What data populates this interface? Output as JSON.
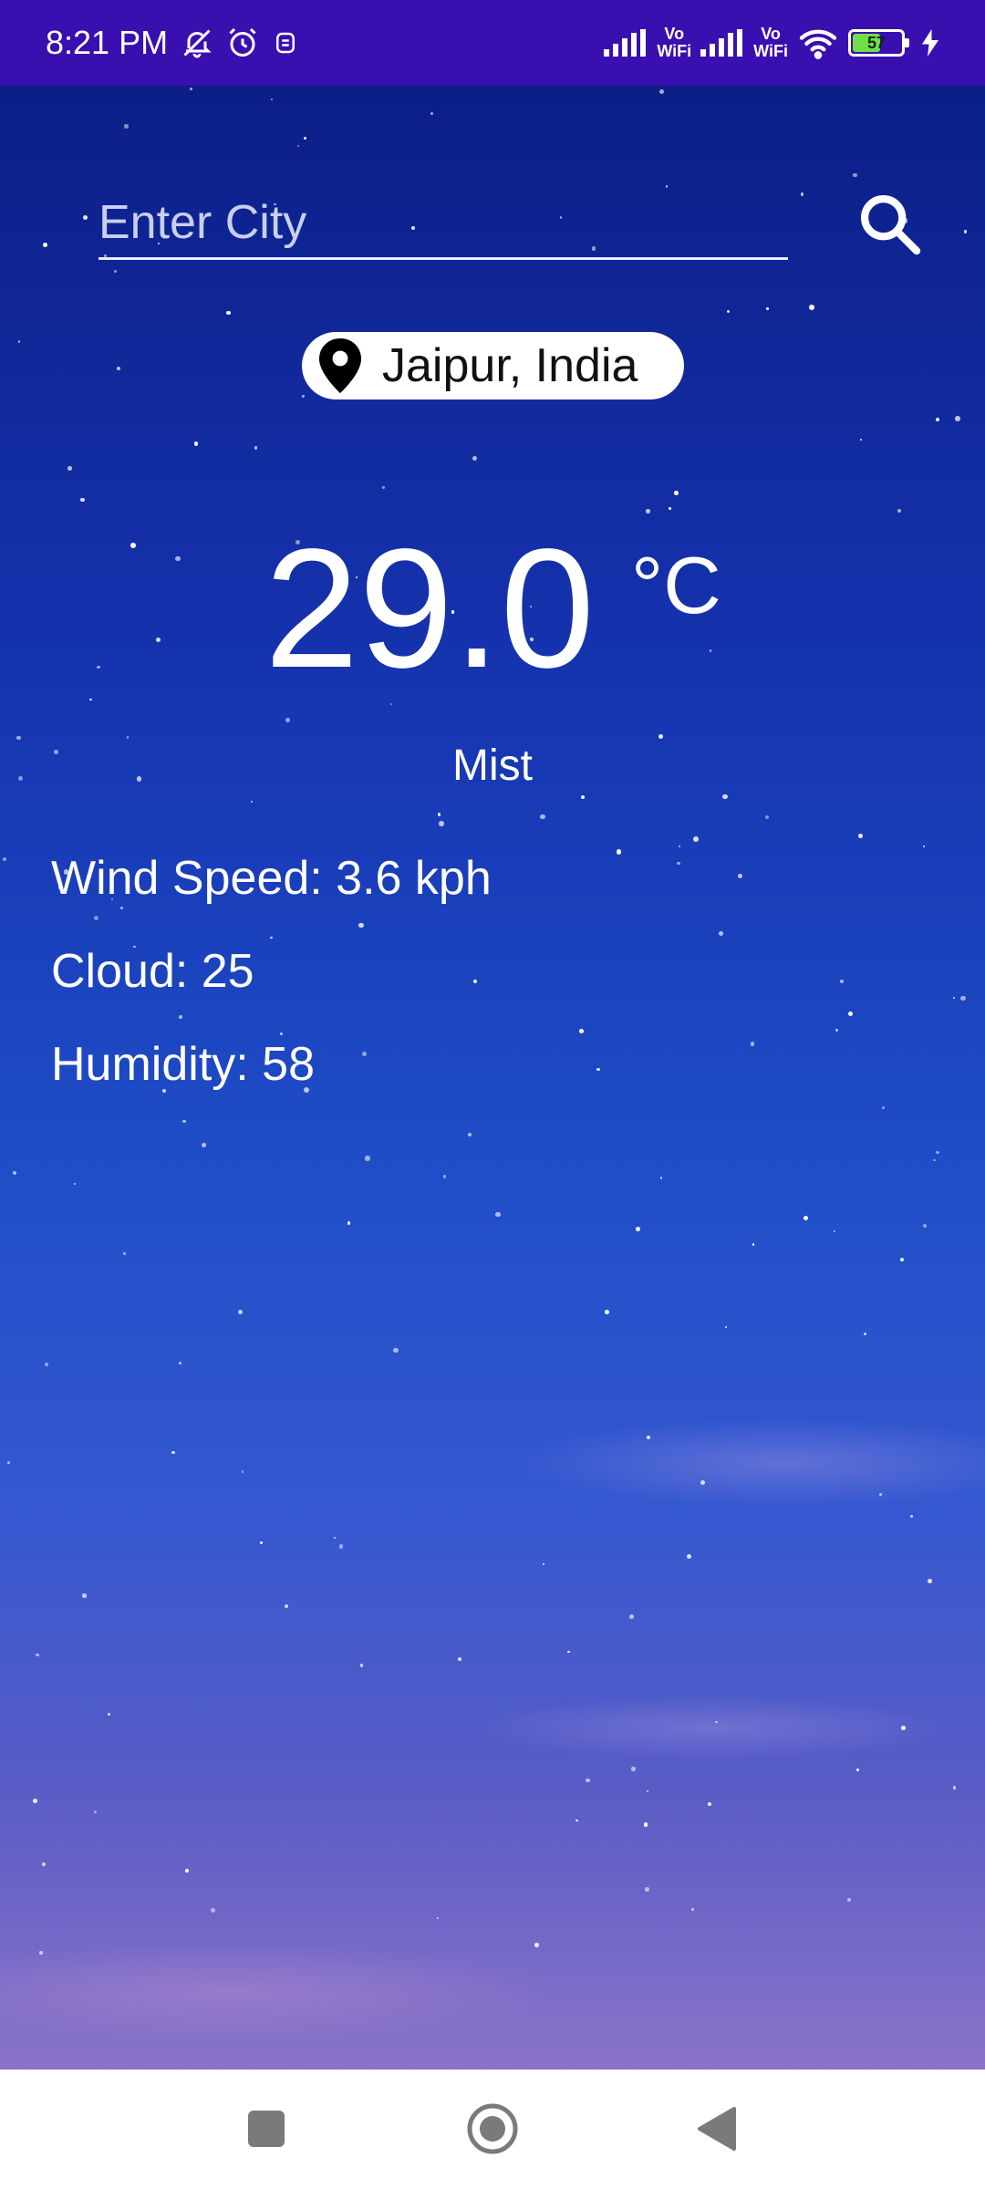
{
  "status_bar": {
    "time": "8:21 PM",
    "icons": [
      "mute-icon",
      "alarm-icon",
      "app-notification-icon",
      "signal-icon",
      "vowifi-icon",
      "signal-icon",
      "vowifi-icon",
      "wifi-icon",
      "battery-icon",
      "charging-icon"
    ],
    "vowifi_label_top": "Vo",
    "vowifi_label_bottom": "WiFi",
    "battery_level": "57",
    "battery_fraction": 0.57
  },
  "search": {
    "placeholder": "Enter City",
    "value": "",
    "icon": "search-icon"
  },
  "location": {
    "icon": "location-pin-icon",
    "label": "Jaipur, India"
  },
  "weather": {
    "temperature": "29.0",
    "unit": "°C",
    "condition": "Mist",
    "wind_speed": "Wind Speed: 3.6 kph",
    "cloud": "Cloud: 25",
    "humidity": "Humidity: 58"
  },
  "nav_bar": {
    "icons": [
      "recents-square-icon",
      "home-circle-icon",
      "back-triangle-icon"
    ]
  },
  "colors": {
    "status_bar": "#3a0fb0",
    "text": "#ffffff",
    "pill": "#ffffff",
    "sky_top": "#0c1e88",
    "sky_bottom": "#8a73c9"
  }
}
